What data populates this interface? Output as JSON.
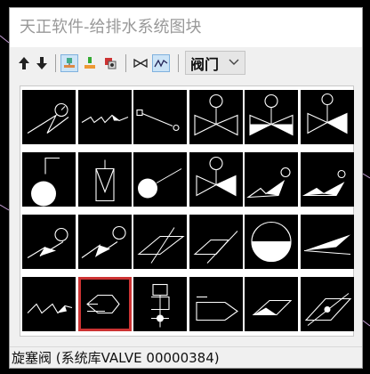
{
  "window": {
    "title": "天正软件-给排水系统图块"
  },
  "toolbar": {
    "buttons": [
      {
        "icon": "arrow-up-icon"
      },
      {
        "icon": "arrow-down-icon"
      },
      {
        "icon": "library-view-icon"
      },
      {
        "icon": "insert-block-icon"
      },
      {
        "icon": "replace-block-icon"
      },
      {
        "icon": "butterfly-valve-icon"
      },
      {
        "icon": "zigzag-view-icon"
      }
    ],
    "category": "阀门"
  },
  "gallery": {
    "selected_index": 19,
    "items": [
      "angle-valve-gauge",
      "zigzag-valve",
      "level-gauge-line",
      "butterfly-valve-actuator",
      "half-filled-butterfly-valve",
      "ball-valve-actuator",
      "float-ball-valve",
      "box-valve-bracket",
      "float-line-valve",
      "half-filled-butterfly-actuator",
      "oblique-valve-filled",
      "oblique-valve-filled-2",
      "oblique-valve-circle",
      "oblique-valve-circle-2",
      "parallelogram-valve",
      "parallelogram-valve-2",
      "half-circle-tank",
      "filled-wedge-valve",
      "flat-zigzag-valve",
      "plug-valve",
      "pressure-valve",
      "pentagon-valve",
      "parallelogram-filled",
      "parallelogram-dot"
    ]
  },
  "status": {
    "text": "旋塞阀  (系统库VALVE 00000384)"
  },
  "colors": {
    "accent_selected": "#cc3333",
    "cell_bg": "#000000",
    "symbol_stroke": "#ffffff"
  }
}
